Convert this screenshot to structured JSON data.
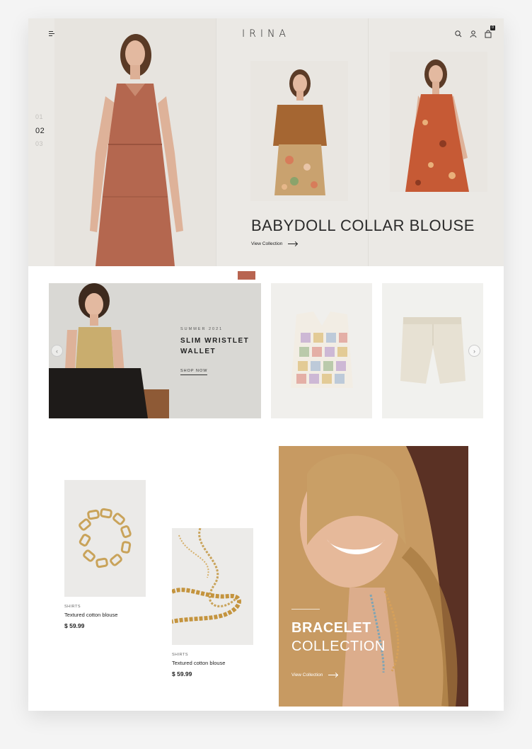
{
  "header": {
    "logo": "IRINA",
    "icons": [
      "menu-icon",
      "search-icon",
      "user-icon",
      "cart-icon"
    ],
    "cart_count": "0"
  },
  "hero": {
    "slide_numbers": [
      "01",
      "02",
      "03"
    ],
    "active_slide": "02",
    "title": "BABYDOLL COLLAR BLOUSE",
    "link_label": "View Collection"
  },
  "promo": {
    "season": "SUMMER 2021",
    "title": "SLIM WRISTLET WALLET",
    "cta": "SHOP NOW"
  },
  "products": [
    {
      "category": "SHIRTS",
      "name": "Textured cotton blouse",
      "price": "$ 59.99"
    },
    {
      "category": "SHIRTS",
      "name": "Textured cotton blouse",
      "price": "$ 59.99"
    }
  ],
  "collection": {
    "title_bold": "BRACELET",
    "title_light": "COLLECTION",
    "link_label": "View Collection"
  },
  "colors": {
    "accent": "#b86450",
    "hero_bg": "#ebe9e5",
    "bracelet_bg": "#5c3326"
  }
}
